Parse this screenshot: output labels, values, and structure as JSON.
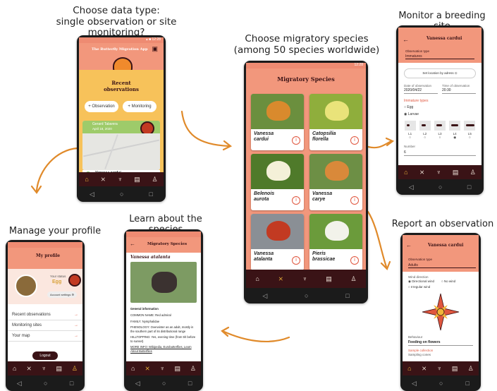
{
  "captions": {
    "choose_type": "Choose data type:\nsingle observation or site monitoring?",
    "choose_species": "Choose migratory species\n(among 50 species worldwide)",
    "monitor_site": "Monitor a breeding site",
    "manage_profile": "Manage your profile",
    "learn_species": "Learn about the species",
    "report_observation": "Report an observation"
  },
  "home": {
    "app_title": "The Butterfly Migration App",
    "section_title": "Recent\nobservations",
    "observation_button": "Observation",
    "monitoring_button": "Monitoring",
    "recent_name": "Gerard Talavera",
    "recent_date": "April 18, 2020",
    "species_name": "Vanessa cardui",
    "species_note": "Species verified"
  },
  "species": {
    "status_time": "12:28",
    "header": "Migratory Species",
    "cards": [
      {
        "name": "Vanessa\ncardui",
        "color": "#6b8f3e",
        "accent": "#d98a2d"
      },
      {
        "name": "Catopsilia\nflorella",
        "color": "#8fae3c",
        "accent": "#e9e37a"
      },
      {
        "name": "Belenois\naurota",
        "color": "#4f7a2a",
        "accent": "#f4f0d8"
      },
      {
        "name": "Vanessa\ncarye",
        "color": "#6d8f45",
        "accent": "#d9893a"
      },
      {
        "name": "Vanessa\natalanta",
        "color": "#8a8f95",
        "accent": "#c23a22"
      },
      {
        "name": "Pieris\nbrassicae",
        "color": "#6b9b3b",
        "accent": "#f2f2ea"
      }
    ]
  },
  "monitor": {
    "header": "Vanessa cardui",
    "obs_type_label": "Observation type",
    "obs_type_value": "Immatures",
    "location_button": "Set location by adress",
    "date_label": "Date of observation",
    "date_value": "2020/04/22",
    "time_label": "Time of observation",
    "time_value": "20:30",
    "immature_label": "Immature types",
    "egg": "Egg",
    "larvae": "Larvae",
    "stages": [
      "L1",
      "L2",
      "L3",
      "L4",
      "L5"
    ],
    "number_label": "Number",
    "number_value": "6"
  },
  "profile": {
    "header": "My profile",
    "status_label": "Your status",
    "status_value": "Egg",
    "account_settings": "Account settings",
    "menu": [
      "Recent observations",
      "Monitoring sites",
      "Your map"
    ],
    "logout": "Logout"
  },
  "learn": {
    "header": "Migratory Species",
    "title": "Vanessa atalanta",
    "general": "General information",
    "common_name": "COMMON NAME: Red admiral",
    "family": "FAMILY: Nymphalidae",
    "phenology": "PHENOLOGY: Overwinter as an adult, mostly in the southern part of its distributional range",
    "hilltopping": "HILLTOPPING: Yes, evening time (from 5h before to sunset)",
    "more_info": "MORE INFO: Wikipedia, Eurobutterflies, Learn About Butterflies"
  },
  "report": {
    "header": "Vanessa cardui",
    "obs_type_label": "Observation type",
    "obs_type_value": "Adults",
    "wind_label": "Wind direction",
    "directional": "Directional wind",
    "no_wind": "No wind",
    "irregular": "Irregular wind",
    "behaviour_label": "Behaviour",
    "behaviour_value": "Feeding on flowers",
    "sample_label": "Sample collection",
    "sampling": "Sampling cones"
  },
  "colors": {
    "salmon": "#f2977c",
    "dark": "#3a1316",
    "accent": "#e0563e",
    "gold": "#f0b53a",
    "arrow": "#e08a2a"
  }
}
